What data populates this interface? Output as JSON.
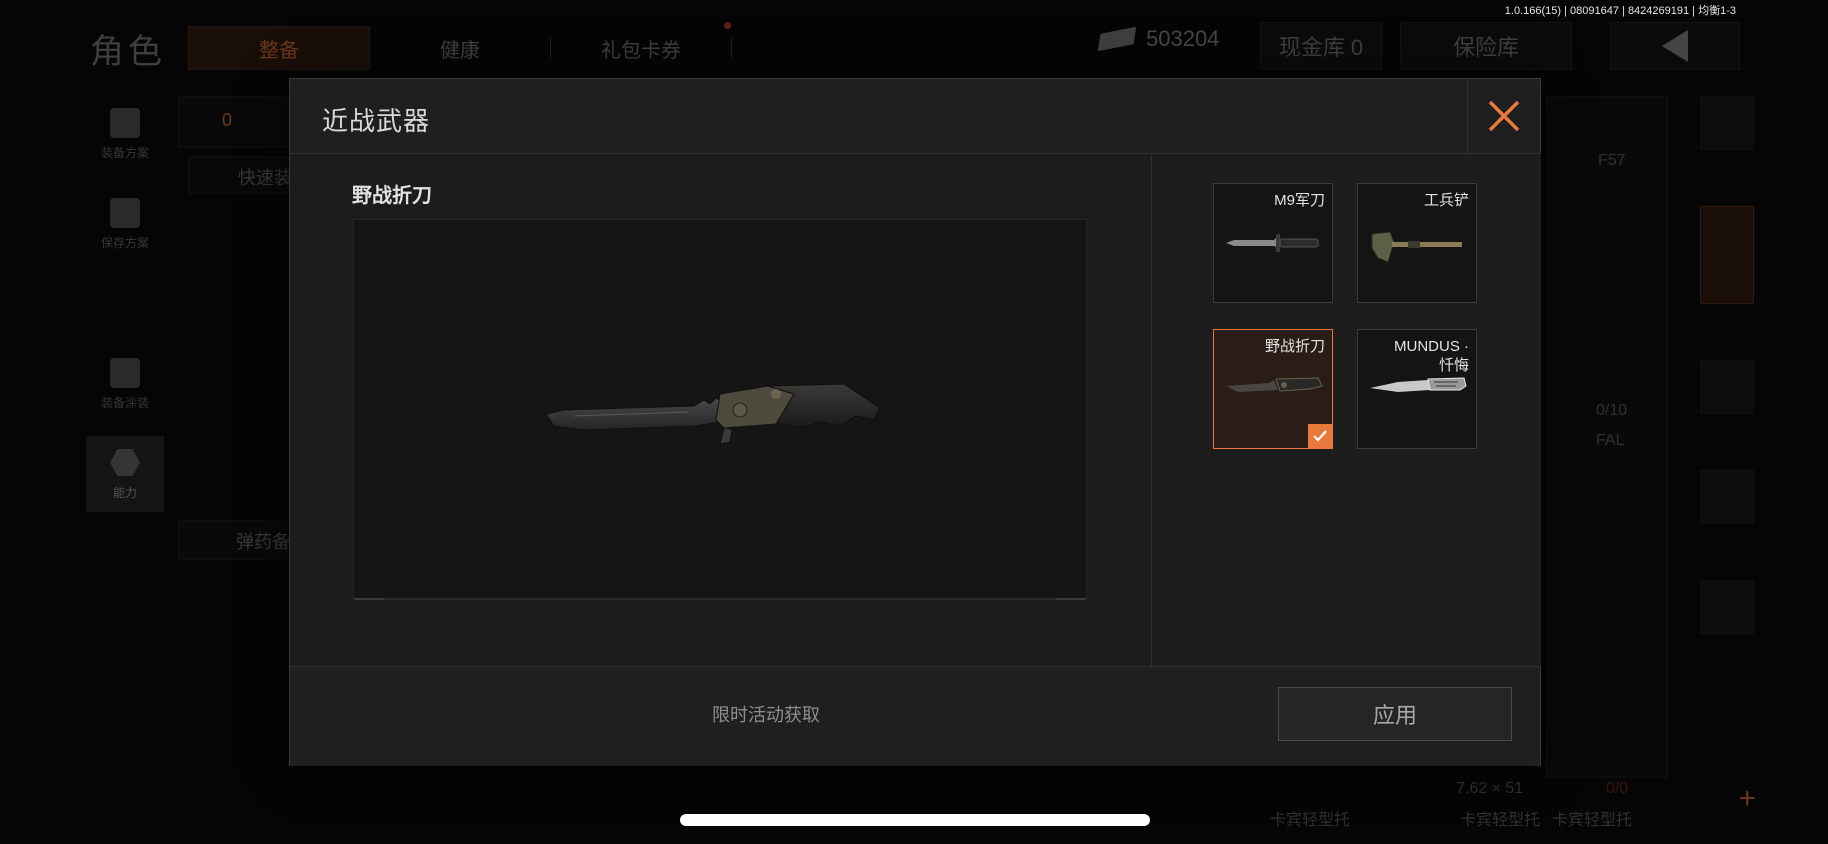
{
  "status": {
    "version": "1.0.166(15) | 08091647 | 8424269191 | 均衡1-3"
  },
  "background": {
    "page_title": "角色",
    "tabs": [
      {
        "label": "整备",
        "active": true
      },
      {
        "label": "健康",
        "active": false
      },
      {
        "label": "礼包卡券",
        "active": false
      }
    ],
    "currency_amount": "503204",
    "cash_vault_label": "现金库 0",
    "safe_label": "保险库",
    "left_nav": [
      {
        "label": "装备方案",
        "icon": "vest-icon"
      },
      {
        "label": "保存方案",
        "icon": "download-icon"
      },
      {
        "label": "装备涂装",
        "icon": "helmet-icon"
      },
      {
        "label": "能力",
        "icon": "ability-icon",
        "active": true
      }
    ],
    "counter": "0",
    "quick_label": "快速装",
    "ammo_label": "弹药备",
    "weapon_1": "F57",
    "ammo_count_1": "0/10",
    "weapon_2": "FAL",
    "caliber": "7.62 × 51",
    "ammo_count_2": "0/0",
    "stock_labels": [
      "卡宾轻型托",
      "卡宾轻型托",
      "卡宾轻型托"
    ]
  },
  "modal": {
    "title": "近战武器",
    "selected_item_name": "野战折刀",
    "items": [
      {
        "name": "M9军刀",
        "selected": false,
        "icon": "bayonet-icon"
      },
      {
        "name": "工兵铲",
        "selected": false,
        "icon": "shovel-icon"
      },
      {
        "name": "野战折刀",
        "selected": true,
        "icon": "folding-knife-icon"
      },
      {
        "name": "MUNDUS · 忏悔",
        "selected": false,
        "icon": "ornate-knife-icon"
      }
    ],
    "source_text": "限时活动获取",
    "apply_label": "应用",
    "accent_color": "#e8793a"
  }
}
